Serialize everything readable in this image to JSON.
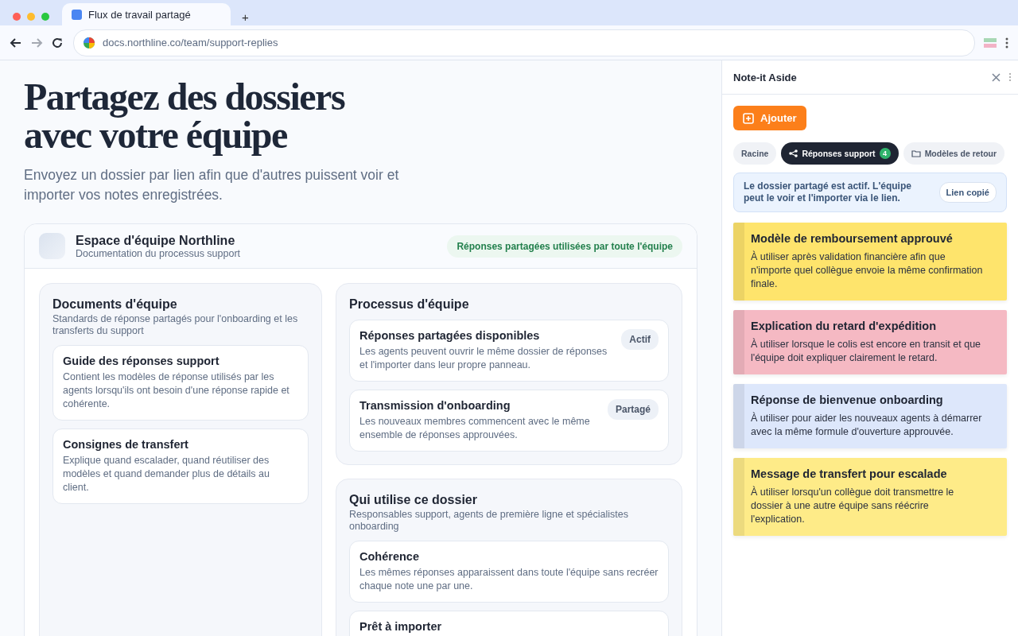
{
  "browser": {
    "tab_title": "Flux de travail partagé",
    "new_tab": "+",
    "url": "docs.northline.co/team/support-replies",
    "forward_disabled": true
  },
  "page": {
    "title": "Partagez des dossiers avec votre équipe",
    "subtitle": "Envoyez un dossier par lien afin que d'autres puissent voir et importer vos notes enregistrées.",
    "workspace": {
      "name": "Espace d'équipe Northline",
      "description": "Documentation du processus support",
      "badge": "Réponses partagées utilisées par toute l'équipe"
    },
    "columns": [
      [
        {
          "title": "Documents d'équipe",
          "description": "Standards de réponse partagés pour l'onboarding et les transferts du support",
          "items": [
            {
              "title": "Guide des réponses support",
              "text": "Contient les modèles de réponse utilisés par les agents lorsqu'ils ont besoin d'une réponse rapide et cohérente."
            },
            {
              "title": "Consignes de transfert",
              "text": "Explique quand escalader, quand réutiliser des modèles et quand demander plus de détails au client."
            }
          ]
        }
      ],
      [
        {
          "title": "Processus d'équipe",
          "items": [
            {
              "title": "Réponses partagées disponibles",
              "text": "Les agents peuvent ouvrir le même dossier de réponses et l'importer dans leur propre panneau.",
              "badge": "Actif"
            },
            {
              "title": "Transmission d'onboarding",
              "text": "Les nouveaux membres commencent avec le même ensemble de réponses approuvées.",
              "badge": "Partagé"
            }
          ]
        },
        {
          "title": "Qui utilise ce dossier",
          "description": "Responsables support, agents de première ligne et spécialistes onboarding",
          "items": [
            {
              "title": "Cohérence",
              "text": "Les mêmes réponses apparaissent dans toute l'équipe sans recréer chaque note une par une."
            },
            {
              "title": "Prêt à importer"
            }
          ]
        }
      ]
    ]
  },
  "panel": {
    "title": "Note-it Aside",
    "add_button": "Ajouter",
    "tabs": [
      {
        "label": "Racine",
        "kind": "plain",
        "selected": false
      },
      {
        "label": "Réponses support",
        "kind": "shared",
        "count": "4",
        "selected": true
      },
      {
        "label": "Modèles de retour",
        "kind": "folder",
        "selected": false
      }
    ],
    "notice": {
      "text": "Le dossier partagé est actif. L'équipe peut le voir et l'importer via le lien.",
      "button": "Lien copié"
    },
    "notes": [
      {
        "title": "Modèle de remboursement approuvé",
        "text": "À utiliser après validation financière afin que n'importe quel collègue envoie la même confirmation finale.",
        "color": "#fee46c"
      },
      {
        "title": "Explication du retard d'expédition",
        "text": "À utiliser lorsque le colis est encore en transit et que l'équipe doit expliquer clairement le retard.",
        "color": "#f5b9c3"
      },
      {
        "title": "Réponse de bienvenue onboarding",
        "text": "À utiliser pour aider les nouveaux agents à démarrer avec la même formule d'ouverture approuvée.",
        "color": "#dde7fb"
      },
      {
        "title": "Message de transfert pour escalade",
        "text": "À utiliser lorsqu'un collègue doit transmettre le dossier à une autre équipe sans réécrire l'explication.",
        "color": "#feeb88"
      }
    ]
  }
}
